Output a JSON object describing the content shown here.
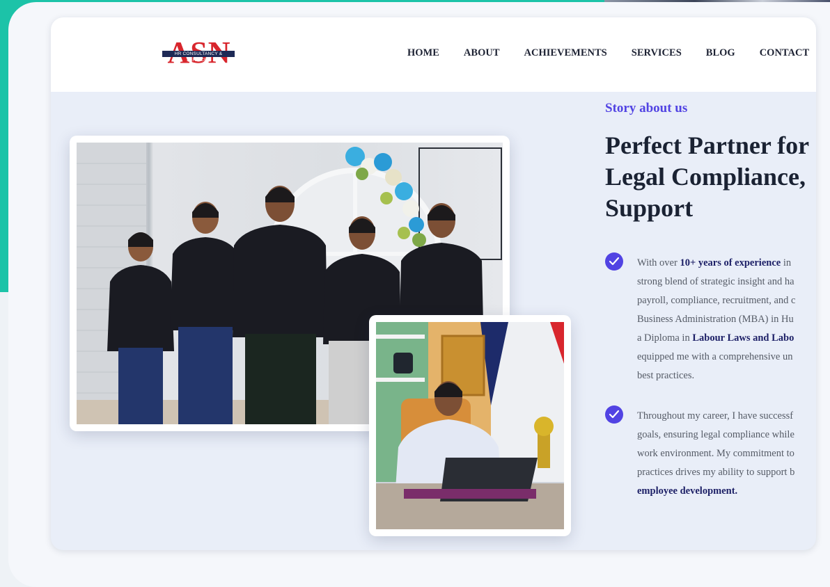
{
  "header": {
    "logo_text": "ASN",
    "logo_tagline": "HR CONSULTANCY & SERVICES",
    "nav": [
      "HOME",
      "ABOUT",
      "ACHIEVEMENTS",
      "SERVICES",
      "BLOG",
      "CONTACT"
    ]
  },
  "about": {
    "eyebrow": "Story about us",
    "headline_lines": [
      "Perfect Partner for",
      "Legal Compliance,",
      "Support"
    ],
    "bullet1": {
      "line1_pre": "With over ",
      "line1_bold": "10+ years of experience",
      "line1_post": " in",
      "line2": "strong blend of strategic insight and ha",
      "line3": "payroll, compliance, recruitment, and c",
      "line4": "Business Administration (MBA) in Hu",
      "line5_pre": "a Diploma in ",
      "line5_bold": "Labour Laws and Labo",
      "line6": "equipped me with a comprehensive un",
      "line7": "best practices."
    },
    "bullet2": {
      "line1": "Throughout my career, I have successf",
      "line2": "goals, ensuring legal compliance while",
      "line3": "work environment. My commitment to",
      "line4": "practices drives my ability to support b",
      "line5_bold": "employee development."
    }
  },
  "colors": {
    "accent": "#5143e3",
    "teal_background": "#1cc3a8",
    "logo_red": "#d8262d",
    "logo_navy": "#1e2a56"
  },
  "icons": [
    "check-circle-icon",
    "check-circle-icon"
  ]
}
